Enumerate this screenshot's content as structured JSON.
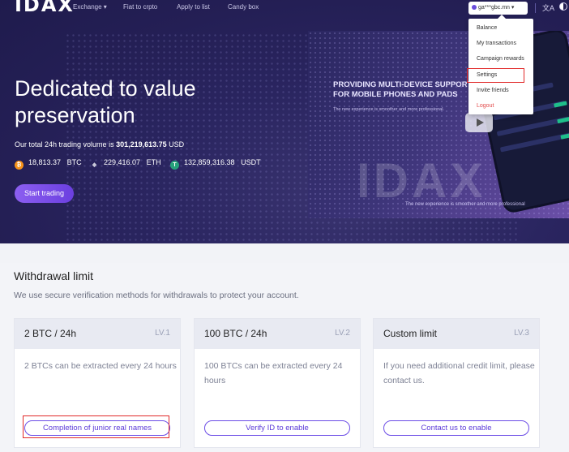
{
  "nav": {
    "logo": "IDAX",
    "items": [
      "Exchange ▾",
      "Fiat to crpto",
      "Apply to list",
      "Candy box"
    ],
    "user": "ga***gbc.mn ▾",
    "lang_icon": "translate-icon",
    "theme_icon": "half-moon-icon"
  },
  "user_menu": {
    "items": [
      "Balance",
      "My transactions",
      "Campaign rewards",
      "Settings",
      "Invite friends",
      "Logout"
    ],
    "highlighted": "Settings"
  },
  "hero": {
    "headline": "Dedicated to value preservation",
    "volume_prefix": "Our total 24h trading volume is",
    "volume_value": "301,219,613.75",
    "volume_unit": "USD",
    "coins": [
      {
        "icon": "bitcoin-icon",
        "amount": "18,813.37",
        "symbol": "BTC",
        "color": "#f7931a"
      },
      {
        "icon": "ethereum-icon",
        "amount": "229,416.07",
        "symbol": "ETH",
        "color": "#5b5f7a"
      },
      {
        "icon": "tether-icon",
        "amount": "132,859,316.38",
        "symbol": "USDT",
        "color": "#26a17b"
      }
    ],
    "start_button": "Start trading"
  },
  "promo": {
    "title": "PROVIDING MULTI-DEVICE SUPPORT FOR MOBILE PHONES AND PADS",
    "subtitle": "The new experience is smoother and more professional.",
    "subtitle2": "The new experience is smoother and more professional",
    "watermark": "IDAX"
  },
  "withdrawal": {
    "title": "Withdrawal limit",
    "description": "We use secure verification methods for withdrawals to protect your account.",
    "cards": [
      {
        "title": "2 BTC / 24h",
        "level": "LV.1",
        "desc": "2 BTCs can be extracted every 24 hours",
        "button": "Completion of junior real names"
      },
      {
        "title": "100 BTC / 24h",
        "level": "LV.2",
        "desc": "100 BTCs can be extracted every 24 hours",
        "button": "Verify ID to enable"
      },
      {
        "title": "Custom limit",
        "level": "LV.3",
        "desc": "If you need additional credit limit, please contact us.",
        "button": "Contact us to enable"
      }
    ]
  },
  "colors": {
    "accent": "#6b4ce6",
    "highlight": "#e12a2a",
    "hero_bg": "#241f55"
  }
}
